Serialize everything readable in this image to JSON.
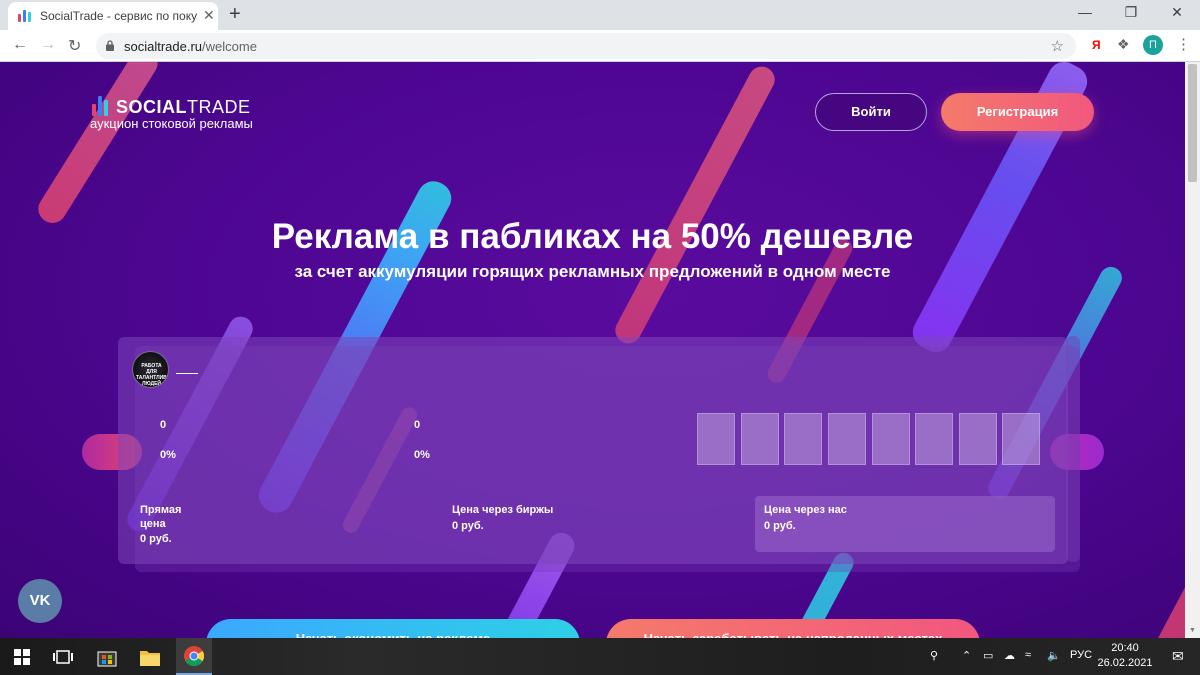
{
  "browser": {
    "tab_title": "SocialTrade - сервис по покупке рекламы",
    "tab_close": "✕",
    "new_tab": "+",
    "url_host": "socialtrade.ru",
    "url_path": "/welcome",
    "profile_initial": "П",
    "ext_ya": "Я"
  },
  "header": {
    "logo_bold": "SOCIAL",
    "logo_light": "TRADE",
    "tagline": "аукцион стоковой рекламы",
    "login_label": "Войти",
    "register_label": "Регистрация"
  },
  "hero": {
    "title": "Реклама в пабликах на 50% дешевле",
    "subtitle": "за счет аккумуляции горящих рекламных предложений в одном месте"
  },
  "card": {
    "channel_avatar_text": "РАБОТА ДЛЯ ТАЛАНТЛИВЫХ ЛЮДЕЙ",
    "stat_left_value": "0",
    "stat_left_percent": "0%",
    "stat_mid_value": "0",
    "stat_mid_percent": "0%",
    "direct_price_label": "Прямая цена",
    "direct_price_value": "0 руб.",
    "exchange_price_label": "Цена через биржы",
    "exchange_price_value": "0 руб.",
    "our_price_label": "Цена через нас",
    "our_price_value": "0 руб."
  },
  "social": {
    "vk_label": "VK"
  },
  "cta": {
    "left_label": "Начать экономить на рекламе",
    "right_label": "Начать зарабатывать на непроданных местах"
  },
  "taskbar": {
    "lang": "РУС",
    "time": "20:40",
    "date": "26.02.2021"
  },
  "colors": {
    "page_bg": "#4c0690",
    "accent_pink": "#f2577f",
    "accent_cyan": "#2ed0e6"
  }
}
